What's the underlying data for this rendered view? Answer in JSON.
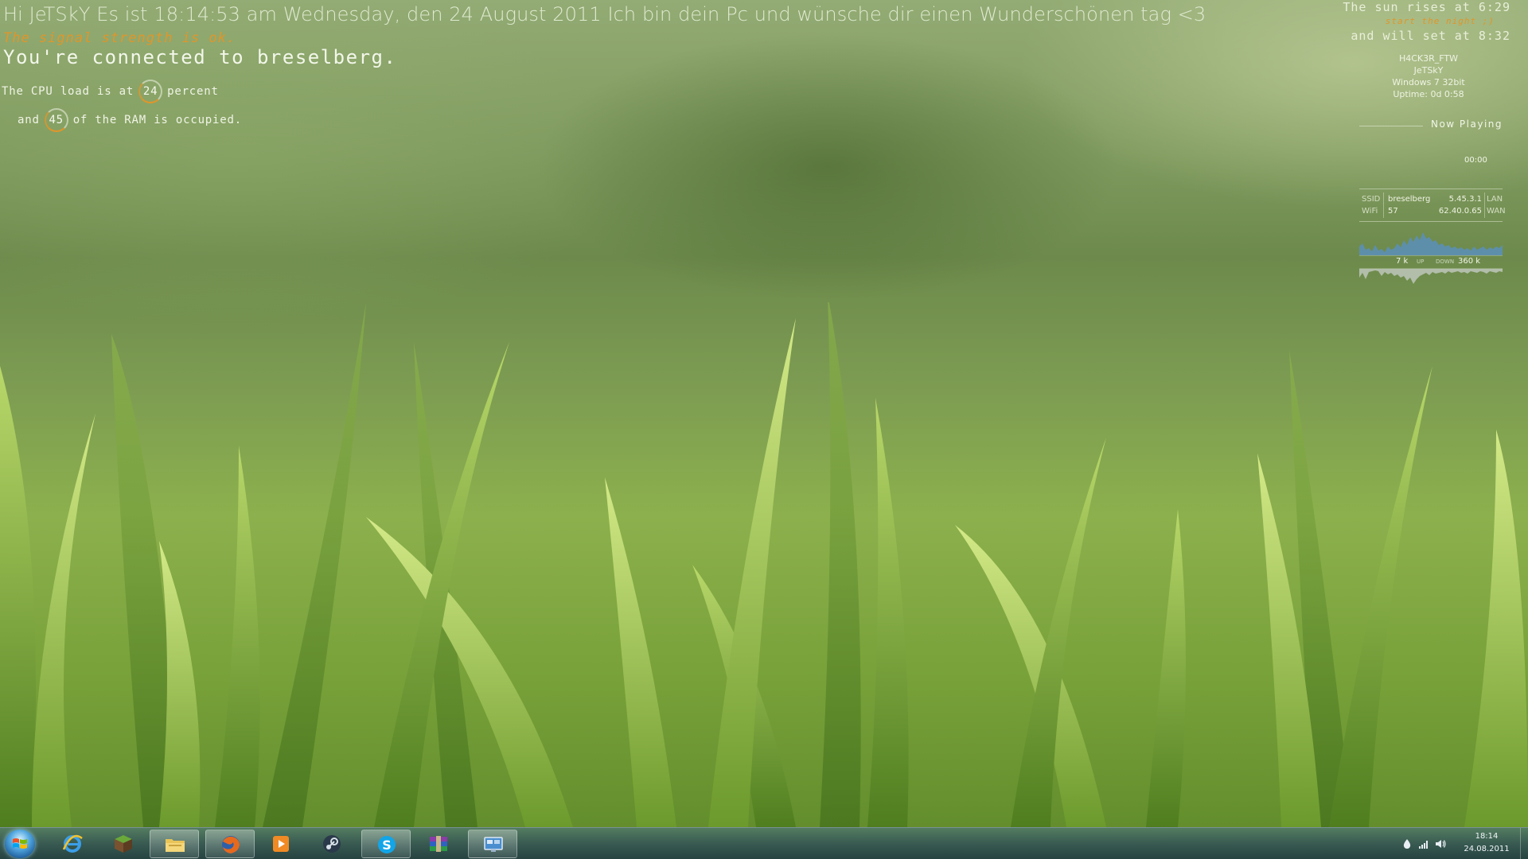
{
  "desktop": {
    "greeting": "Hi JeTSkY Es ist 18:14:53 am Wednesday, den 24 August 2011 Ich bin dein Pc und wünsche dir einen Wunderschönen tag <3",
    "signal": "The signal strength is ok.",
    "connected": "You're connected to breselberg.",
    "cpu": {
      "prefix": "The CPU load is at",
      "value": "24",
      "suffix": "percent"
    },
    "ram": {
      "prefix": "and",
      "value": "45",
      "suffix": "of the RAM is occupied."
    }
  },
  "sun": {
    "rise": "The sun rises at 6:29",
    "sub": "start the night ;)",
    "set": "and will set at 8:32"
  },
  "sysinfo": {
    "computer": "H4CK3R_FTW",
    "user": "JeTSkY",
    "os": "Windows 7 32bit",
    "uptime": "Uptime: 0d 0:58"
  },
  "media": {
    "label": "Now Playing",
    "time": "00:00"
  },
  "network": {
    "ssid_label": "SSID",
    "ssid": "breselberg",
    "lan_ip": "5.45.3.1",
    "lan_label": "LAN",
    "wifi_label": "WiFi",
    "wifi": "57",
    "wan_ip": "62.40.0.65",
    "wan_label": "WAN",
    "up_value": "7 k",
    "up_label": "UP",
    "down_label": "DOWN",
    "down_value": "360 k"
  },
  "taskbar": {
    "items": [
      {
        "name": "start-button",
        "icon": "windows-flag-icon"
      },
      {
        "name": "internet-explorer",
        "icon": "internet-explorer-icon"
      },
      {
        "name": "minecraft",
        "icon": "minecraft-block-icon"
      },
      {
        "name": "file-explorer",
        "icon": "folder-icon",
        "active": true
      },
      {
        "name": "firefox",
        "icon": "firefox-icon",
        "active": true
      },
      {
        "name": "media-player",
        "icon": "media-player-icon"
      },
      {
        "name": "steam",
        "icon": "steam-icon"
      },
      {
        "name": "skype",
        "icon": "skype-icon",
        "active": true
      },
      {
        "name": "winrar",
        "icon": "winrar-icon"
      },
      {
        "name": "remote-desktop",
        "icon": "remote-desktop-icon",
        "active": true
      }
    ],
    "clock_time": "18:14",
    "clock_date": "24.08.2011"
  },
  "colors": {
    "accent_orange": "#e0962a",
    "text_light": "#eef3e2",
    "graph_up": "#5b8fb5",
    "graph_down": "#b9c2b5"
  }
}
